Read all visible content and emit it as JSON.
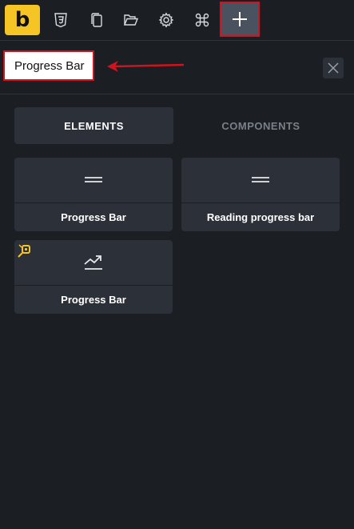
{
  "toolbar": {
    "logo_letter": "b",
    "icons": [
      "css3-icon",
      "pages-icon",
      "folder-open-icon",
      "settings-gear-icon",
      "command-icon",
      "plus-icon"
    ],
    "active_icon": "plus-icon"
  },
  "search": {
    "value": "Progress Bar",
    "clear_icon": "close-icon"
  },
  "tabs": [
    {
      "label": "ELEMENTS",
      "active": true
    },
    {
      "label": "COMPONENTS",
      "active": false
    }
  ],
  "results": [
    {
      "label": "Progress Bar",
      "icon": "horizontal-lines-icon"
    },
    {
      "label": "Reading progress bar",
      "icon": "horizontal-lines-icon"
    },
    {
      "label": "Progress Bar",
      "icon": "trend-line-icon",
      "badge": "third-party-badge-icon"
    }
  ],
  "colors": {
    "background": "#1b1e23",
    "card": "#2c3038",
    "logo": "#f5c526",
    "highlight_red": "#d0131c",
    "active_button": "#4a5260"
  }
}
